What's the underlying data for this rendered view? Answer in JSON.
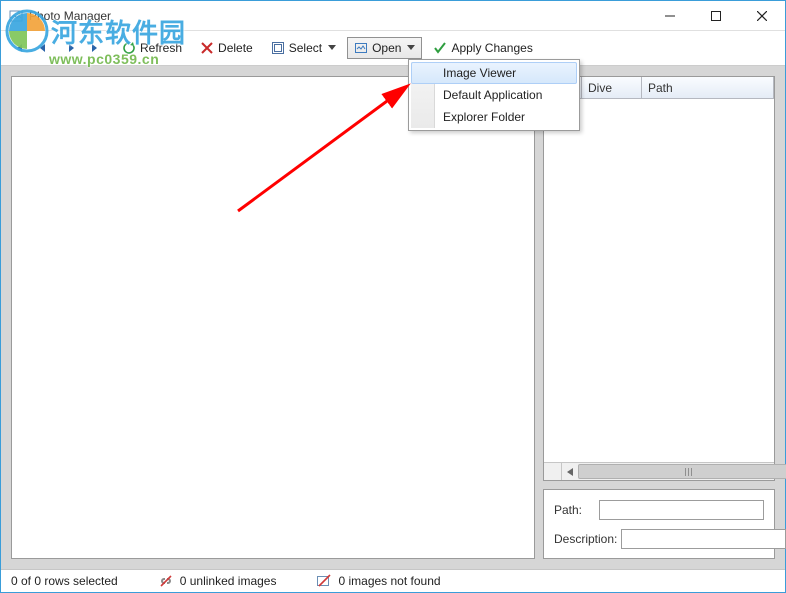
{
  "window": {
    "title": "Photo Manager"
  },
  "toolbar": {
    "refresh": "Refresh",
    "delete": "Delete",
    "select": "Select",
    "open": "Open",
    "apply": "Apply Changes"
  },
  "grid": {
    "columns": {
      "dive": "Dive",
      "path": "Path"
    }
  },
  "open_menu": {
    "items": [
      "Image Viewer",
      "Default Application",
      "Explorer Folder"
    ]
  },
  "details": {
    "path_label": "Path:",
    "description_label": "Description:",
    "path_value": "",
    "description_value": ""
  },
  "status": {
    "selection": "0 of 0 rows selected",
    "unlinked": "0 unlinked images",
    "notfound": "0 images not found"
  },
  "watermark": {
    "cn": "河东软件园",
    "url": "www.pc0359.cn"
  }
}
